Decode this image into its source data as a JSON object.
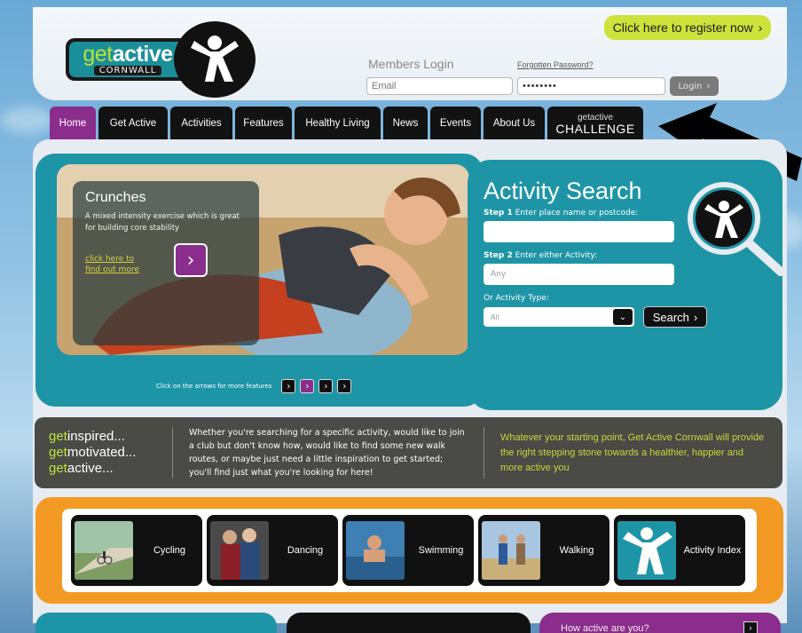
{
  "header": {
    "logo": {
      "get": "get",
      "active": "active",
      "county": "CORNWALL"
    },
    "register_label": "Click here to register now",
    "register_icon": "chevron-right-icon",
    "members_title": "Members Login",
    "forgot_label": "Forgotten Password?",
    "email_placeholder": "Email",
    "password_value": "••••••••",
    "login_label": "Login"
  },
  "nav": {
    "items": [
      "Home",
      "Get Active",
      "Activities",
      "Features",
      "Healthy Living",
      "News",
      "Events",
      "About Us"
    ],
    "active": "Home",
    "challenge_small": "getactive",
    "challenge_big": "CHALLENGE"
  },
  "feature": {
    "title": "Crunches",
    "description": "A mixed intensity exercise which is great for building core stability",
    "link": "click here to find out more",
    "arrows_label": "Click on the arrows for more features"
  },
  "search": {
    "title": "Activity Search",
    "step1_bold": "Step 1",
    "step1_text": "Enter place name or postcode:",
    "step2_bold": "Step 2",
    "step2_text": "Enter either Activity:",
    "activity_placeholder": "Any",
    "type_label": "Or Activity Type:",
    "type_value": "All",
    "button_label": "Search"
  },
  "inspire": {
    "lines": [
      {
        "prefix": "get",
        "word": "inspired..."
      },
      {
        "prefix": "get",
        "word": "motivated..."
      },
      {
        "prefix": "get",
        "word": "active..."
      }
    ],
    "middle": "Whether you're searching for a specific activity, would like to join a club but don't know how, would like to find some new walk routes, or maybe just need a little inspiration to get started; you'll find just what you're looking for here!",
    "right": "Whatever your starting point, Get Active Cornwall will provide the right stepping stone towards a healthier, happier and more active you"
  },
  "activities": [
    {
      "label": "Cycling"
    },
    {
      "label": "Dancing"
    },
    {
      "label": "Swimming"
    },
    {
      "label": "Walking"
    },
    {
      "label": "Activity Index"
    }
  ],
  "bottom": {
    "how_active": "How active are you?"
  },
  "colors": {
    "teal": "#1e95a6",
    "purple": "#8b2d8c",
    "lime": "#cde23a",
    "orange": "#f39a24"
  }
}
